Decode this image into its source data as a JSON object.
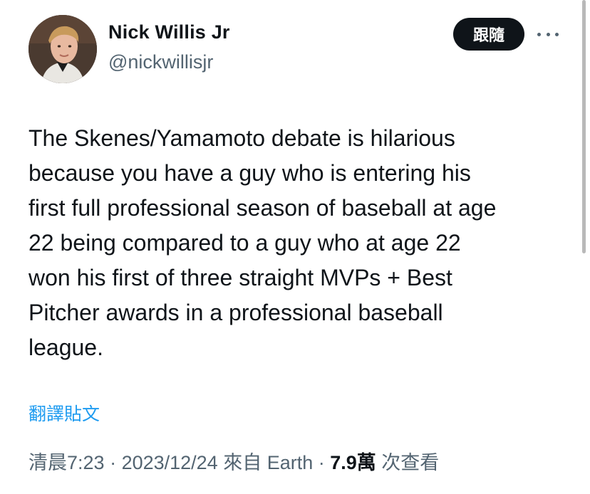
{
  "author": {
    "name": "Nick Willis Jr",
    "handle": "@nickwillisjr"
  },
  "header": {
    "follow_label": "跟隨",
    "more_icon": "more-horizontal-icon"
  },
  "tweet": {
    "lines": [
      "The Skenes/Yamamoto debate is hilarious",
      "because you have a guy who is entering his",
      "first full professional season of baseball at age",
      "22 being compared to a guy who at age 22",
      "won his first of three straight MVPs + Best",
      "Pitcher awards in a professional baseball",
      "league."
    ],
    "translate_label": "翻譯貼文"
  },
  "meta": {
    "time": "清晨7:23",
    "sep1": " · ",
    "date": "2023/12/24",
    "source": " 來自 Earth",
    "sep2": " · ",
    "views": "7.9萬",
    "views_label": " 次查看"
  },
  "colors": {
    "accent": "#1d9bf0",
    "text": "#0f1419",
    "secondary": "#536471"
  }
}
